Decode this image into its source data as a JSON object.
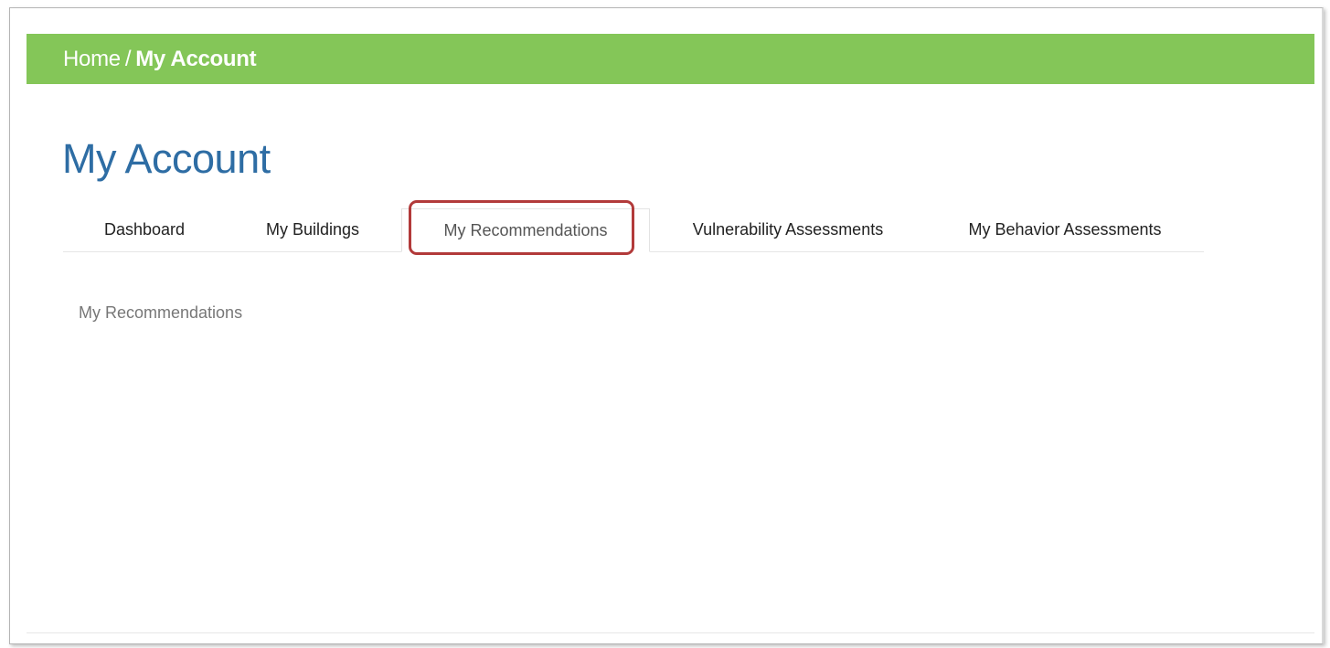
{
  "breadcrumb": {
    "home_label": "Home",
    "separator": "/",
    "current_label": "My Account"
  },
  "page": {
    "title": "My Account"
  },
  "tabs": [
    {
      "label": "Dashboard",
      "active": false
    },
    {
      "label": "My Buildings",
      "active": false
    },
    {
      "label": "My Recommendations",
      "active": true
    },
    {
      "label": "Vulnerability Assessments",
      "active": false
    },
    {
      "label": "My Behavior Assessments",
      "active": false
    }
  ],
  "tab_content": {
    "heading": "My Recommendations"
  },
  "colors": {
    "breadcrumb_bar": "#84c658",
    "title": "#2e6da4",
    "highlight_outline": "#b23a3a"
  }
}
